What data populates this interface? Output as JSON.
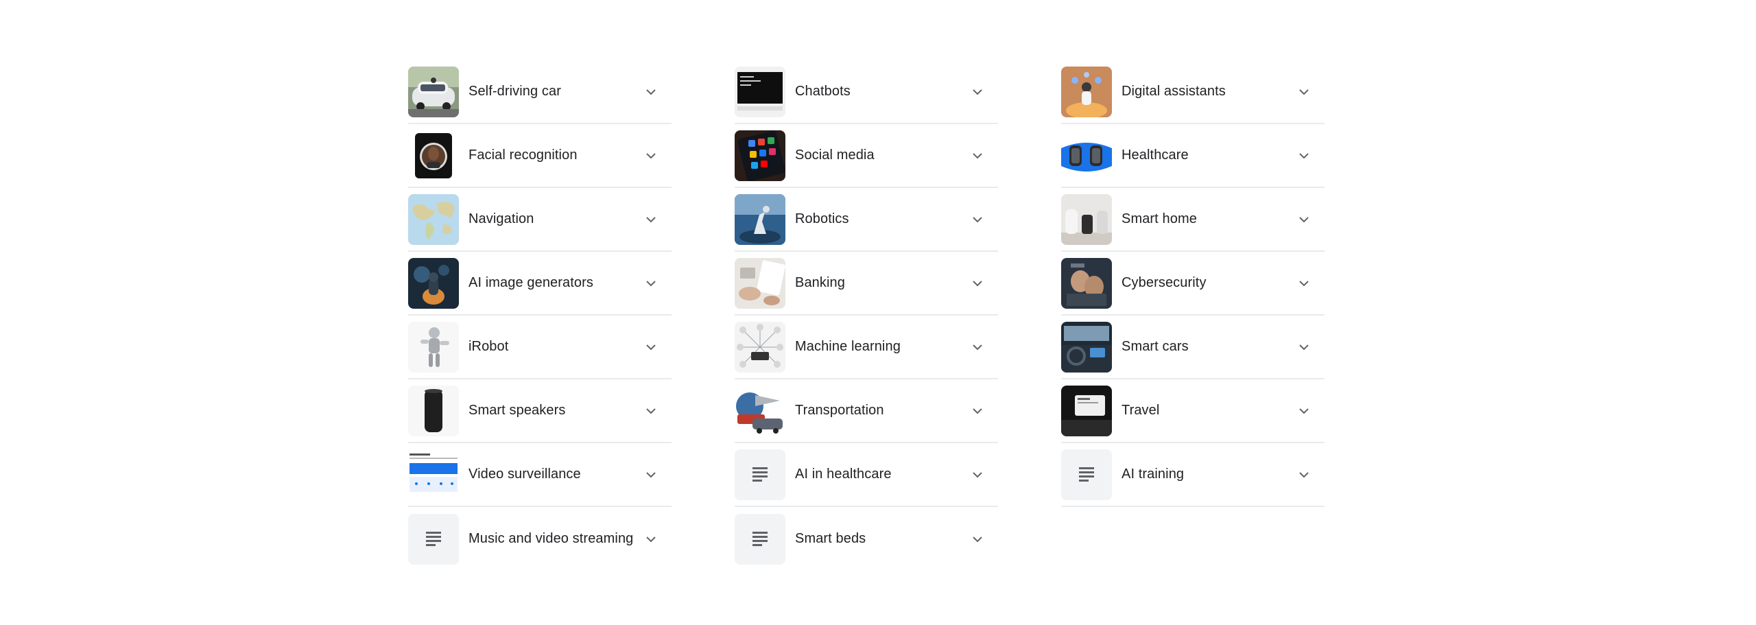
{
  "columns": [
    {
      "items": [
        {
          "label": "Self-driving car",
          "thumb": "car-photo"
        },
        {
          "label": "Facial recognition",
          "thumb": "face-photo"
        },
        {
          "label": "Navigation",
          "thumb": "map-photo"
        },
        {
          "label": "AI image generators",
          "thumb": "ai-art-photo"
        },
        {
          "label": "iRobot",
          "thumb": "robot-photo"
        },
        {
          "label": "Smart speakers",
          "thumb": "speaker-photo"
        },
        {
          "label": "Video surveillance",
          "thumb": "dashboard-screenshot"
        },
        {
          "label": "Music and video streaming",
          "thumb": "document-icon"
        }
      ]
    },
    {
      "items": [
        {
          "label": "Chatbots",
          "thumb": "terminal-screenshot"
        },
        {
          "label": "Social media",
          "thumb": "phone-apps-photo"
        },
        {
          "label": "Robotics",
          "thumb": "robot-arm-photo"
        },
        {
          "label": "Banking",
          "thumb": "banking-photo"
        },
        {
          "label": "Machine learning",
          "thumb": "network-diagram"
        },
        {
          "label": "Transportation",
          "thumb": "transport-collage"
        },
        {
          "label": "AI in healthcare",
          "thumb": "document-icon"
        },
        {
          "label": "Smart beds",
          "thumb": "document-icon"
        }
      ]
    },
    {
      "items": [
        {
          "label": "Digital assistants",
          "thumb": "assistant-illustration"
        },
        {
          "label": "Healthcare",
          "thumb": "smartwatch-photo"
        },
        {
          "label": "Smart home",
          "thumb": "smart-home-devices-photo"
        },
        {
          "label": "Cybersecurity",
          "thumb": "cybersecurity-photo"
        },
        {
          "label": "Smart cars",
          "thumb": "car-interior-photo"
        },
        {
          "label": "Travel",
          "thumb": "car-display-photo"
        },
        {
          "label": "AI training",
          "thumb": "document-icon"
        }
      ]
    }
  ],
  "colors": {
    "divider": "#e8eaed",
    "text": "#202124",
    "icon": "#5f6368",
    "doc_bg": "#f1f3f4"
  }
}
